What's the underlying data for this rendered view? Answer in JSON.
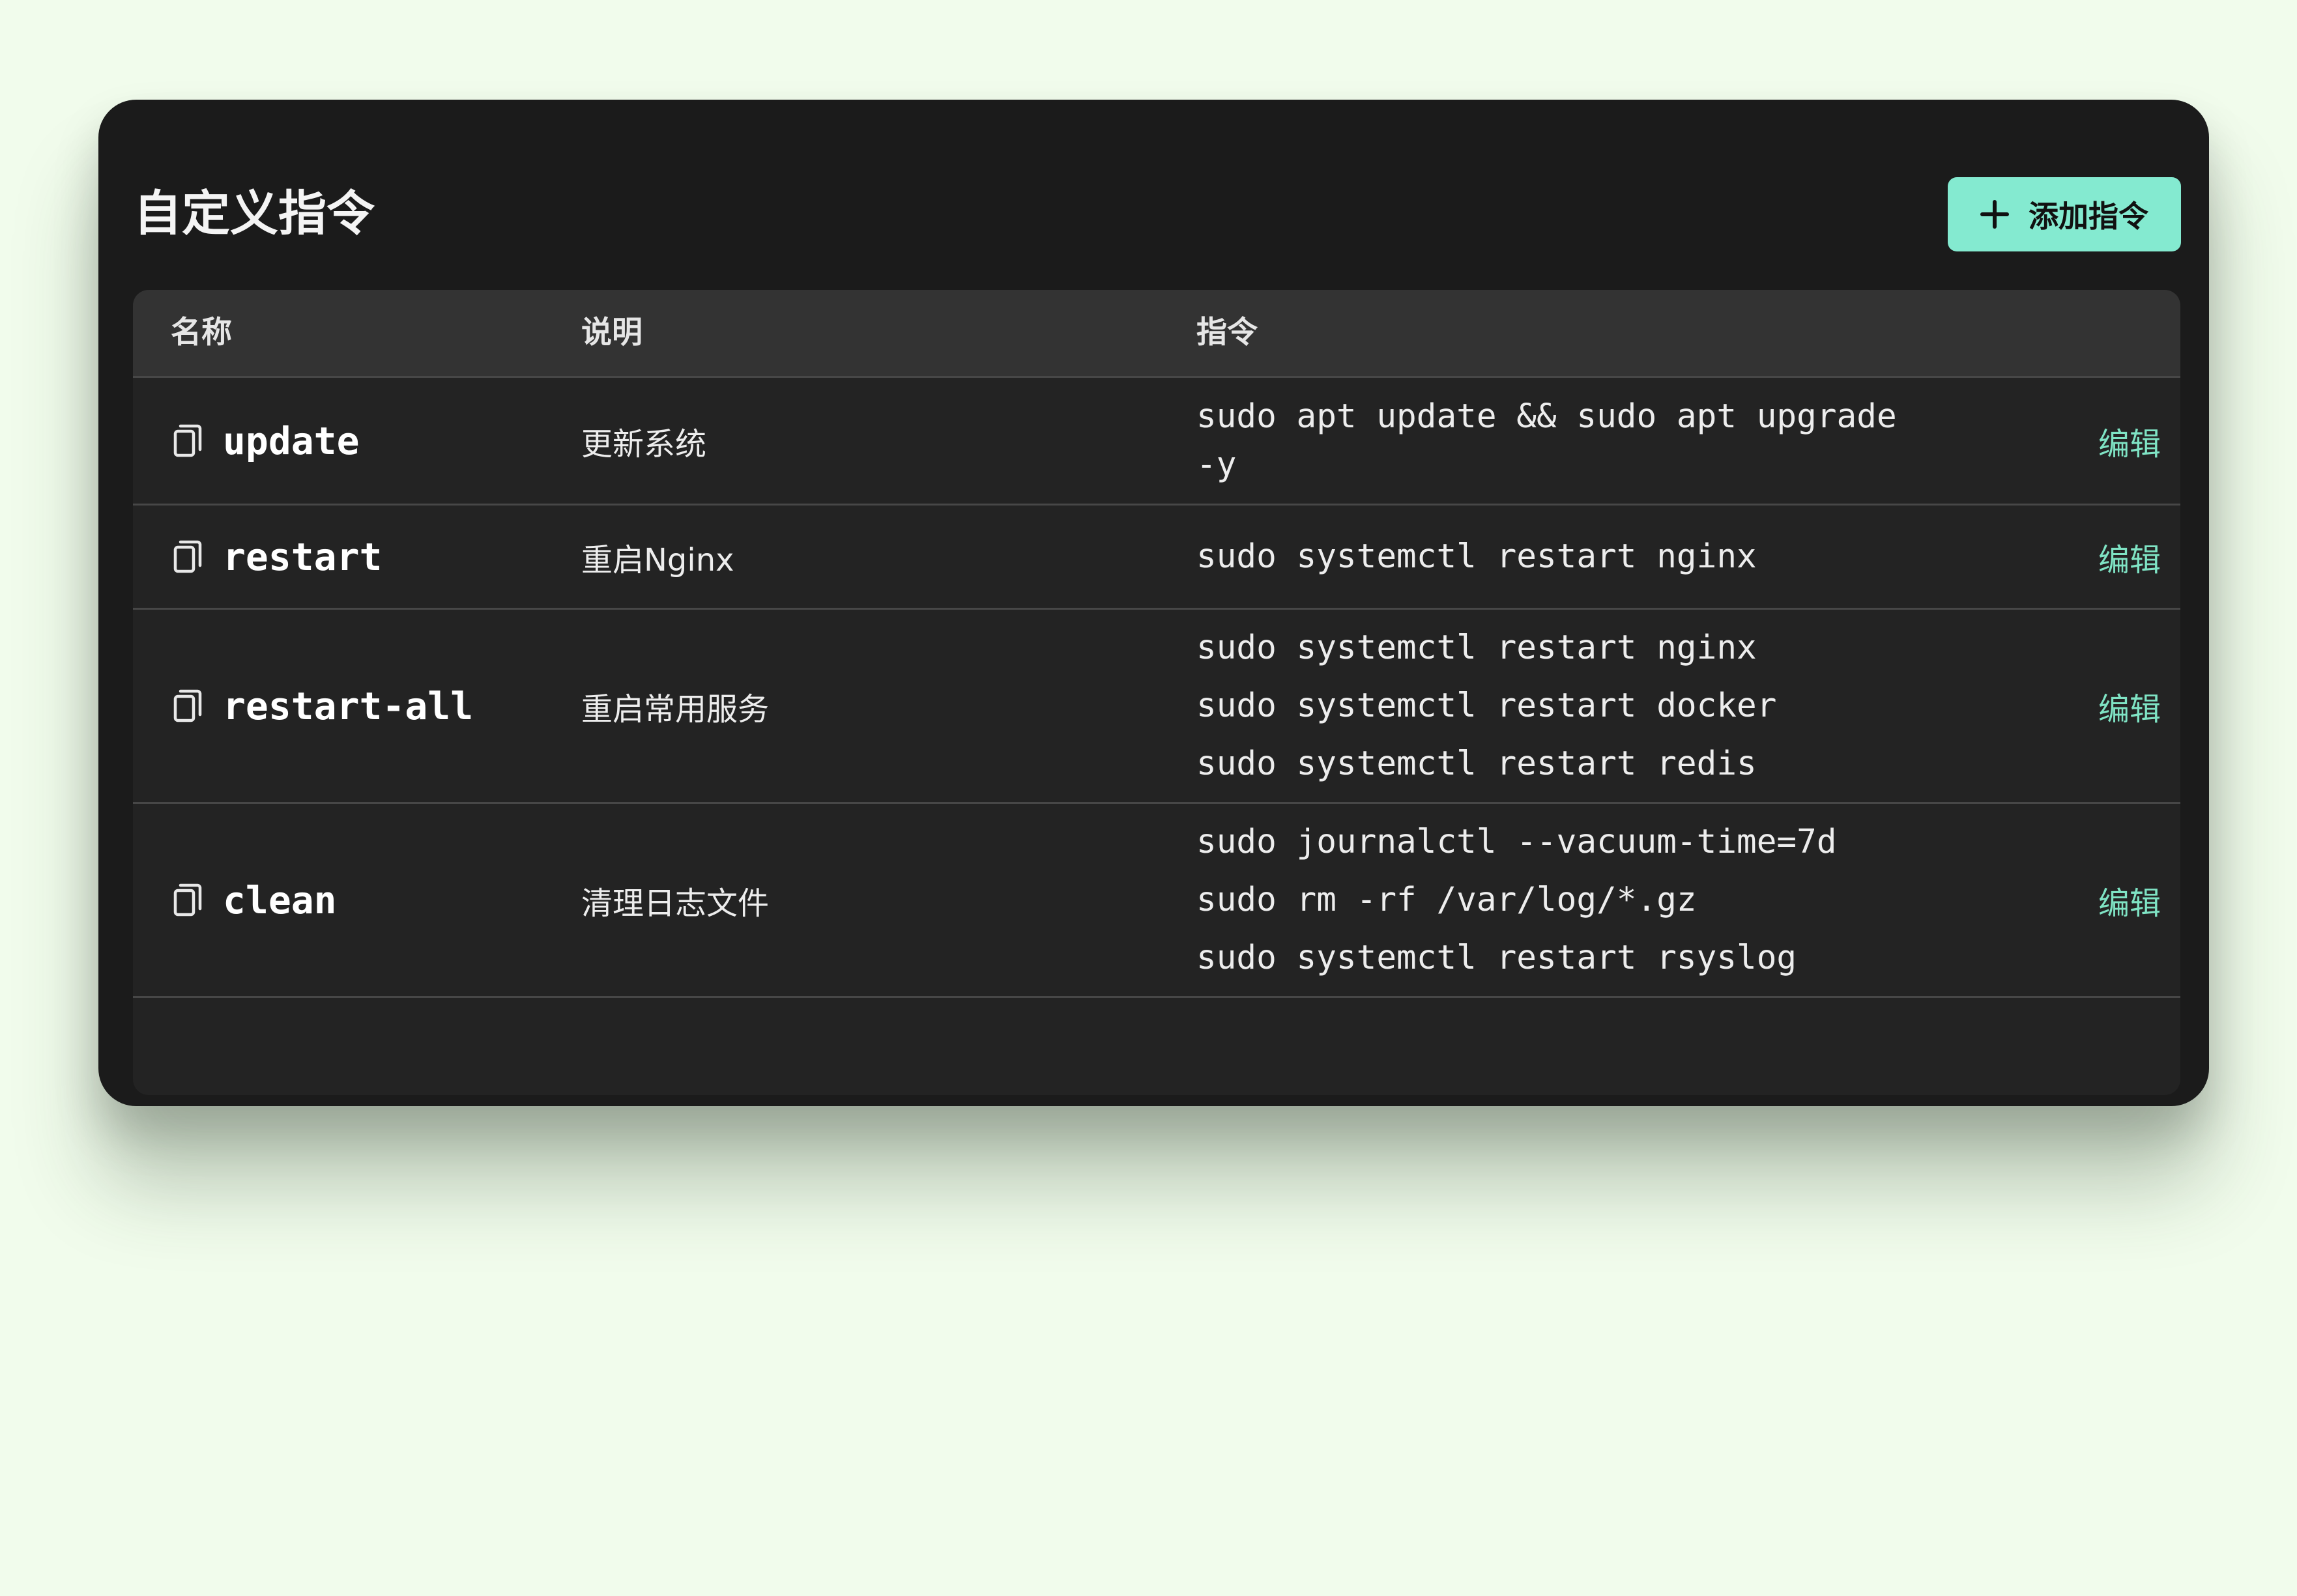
{
  "panel": {
    "title": "自定义指令",
    "add_button_label": "添加指令"
  },
  "table": {
    "headers": {
      "name": "名称",
      "description": "说明",
      "command": "指令"
    },
    "rows": [
      {
        "name": "update",
        "description": "更新系统",
        "commands": [
          "sudo apt update && sudo apt upgrade",
          "-y"
        ],
        "edit_label": "编辑"
      },
      {
        "name": "restart",
        "description": "重启Nginx",
        "commands": [
          "sudo systemctl restart nginx"
        ],
        "edit_label": "编辑"
      },
      {
        "name": "restart-all",
        "description": "重启常用服务",
        "commands": [
          "sudo systemctl restart nginx",
          "sudo systemctl restart docker",
          "sudo systemctl restart redis"
        ],
        "edit_label": "编辑"
      },
      {
        "name": "clean",
        "description": "清理日志文件",
        "commands": [
          "sudo journalctl --vacuum-time=7d",
          "sudo rm -rf /var/log/*.gz",
          "sudo systemctl restart rsyslog"
        ],
        "edit_label": "编辑"
      }
    ]
  },
  "icons": {
    "add": "plus-icon",
    "copy": "copy-icon"
  },
  "colors": {
    "page_background": "#f1fcec",
    "card_background": "#1b1b1b",
    "table_background": "#232323",
    "header_background": "#333333",
    "accent": "#84ead0",
    "edit_link": "#7fe3c4"
  }
}
